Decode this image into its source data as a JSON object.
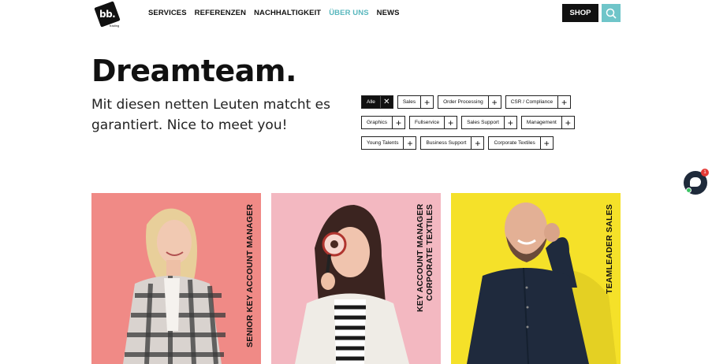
{
  "header": {
    "logo_text": "bb.",
    "logo_sub": "trading",
    "nav": [
      "SERVICES",
      "REFERENZEN",
      "NACHHALTIGKEIT",
      "ÜBER UNS",
      "NEWS"
    ],
    "active_nav": "ÜBER UNS",
    "shop_label": "SHOP",
    "search_icon": "search-icon"
  },
  "hero": {
    "title": "Dreamteam.",
    "subtitle": "Mit diesen netten Leuten matcht es garantiert. Nice to meet you!"
  },
  "filters": {
    "rows": [
      [
        "Alle",
        "Sales",
        "Order Processing",
        "CSR / Compliance"
      ],
      [
        "Graphics",
        "Fullservice",
        "Sales Support",
        "Management"
      ],
      [
        "Young Talents",
        "Business Support",
        "Corporate Textiles"
      ]
    ],
    "active": "Alle"
  },
  "chat": {
    "badge_count": "1"
  },
  "cards": [
    {
      "role": "SENIOR KEY ACCOUNT MANAGER",
      "bg": "#f08a86"
    },
    {
      "role": "KEY ACCOUNT MANAGER CORPORATE TEXTILES",
      "bg": "#f3b8c1"
    },
    {
      "role": "TEAMLEADER SALES",
      "bg": "#f5e129"
    }
  ]
}
